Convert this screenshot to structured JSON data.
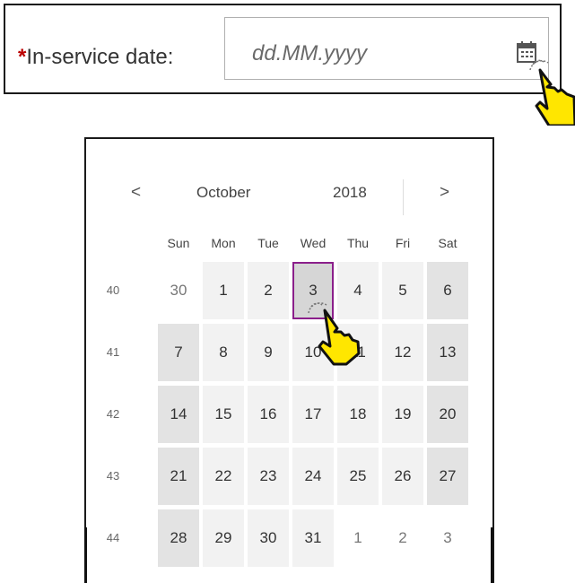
{
  "field": {
    "required_mark": "*",
    "label": "In-service date:",
    "placeholder": "dd.MM.yyyy",
    "icon": "calendar-icon"
  },
  "calendar": {
    "prev": "<",
    "next": ">",
    "month": "October",
    "year": "2018",
    "weekday_headers": [
      "Sun",
      "Mon",
      "Tue",
      "Wed",
      "Thu",
      "Fri",
      "Sat"
    ],
    "weeks": [
      {
        "number": "40",
        "days": [
          "30",
          "1",
          "2",
          "3",
          "4",
          "5",
          "6"
        ]
      },
      {
        "number": "41",
        "days": [
          "7",
          "8",
          "9",
          "10",
          "11",
          "12",
          "13"
        ]
      },
      {
        "number": "42",
        "days": [
          "14",
          "15",
          "16",
          "17",
          "18",
          "19",
          "20"
        ]
      },
      {
        "number": "43",
        "days": [
          "21",
          "22",
          "23",
          "24",
          "25",
          "26",
          "27"
        ]
      },
      {
        "number": "44",
        "days": [
          "28",
          "29",
          "30",
          "31",
          "1",
          "2",
          "3"
        ]
      }
    ],
    "selected_day": "3",
    "colors": {
      "required": "#bb0000",
      "selection_border": "#8b1f8b",
      "day_bg": "#f2f2f2",
      "weekend_bg": "#e3e3e3",
      "cursor_fill": "#ffe600"
    }
  }
}
